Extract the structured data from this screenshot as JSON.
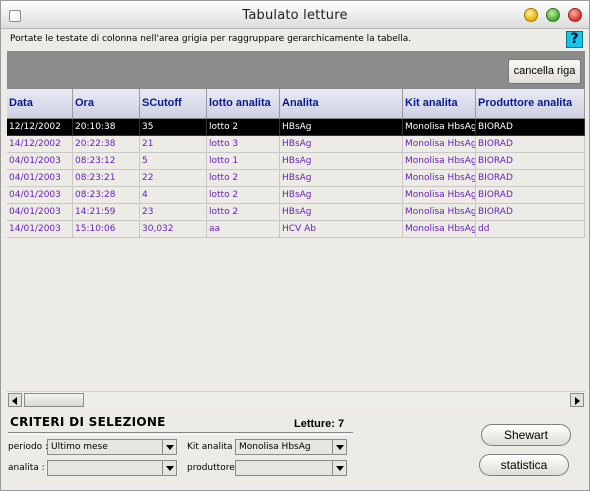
{
  "window": {
    "title": "Tabulato letture"
  },
  "instruction": "Portate le testate di colonna nell'area grigia per raggruppare gerarchicamente la tabella.",
  "help_label": "?",
  "cancella_label": "cancella riga",
  "table": {
    "columns": [
      "Data",
      "Ora",
      "SCutoff",
      "lotto analita",
      "Analita",
      "Kit analita",
      "Produttore analita"
    ],
    "rows": [
      [
        "12/12/2002",
        "20:10:38",
        "35",
        "lotto 2",
        "HBsAg",
        "Monolisa HbsAg",
        "BIORAD"
      ],
      [
        "14/12/2002",
        "20:22:38",
        "21",
        "lotto 3",
        "HBsAg",
        "Monolisa HbsAg",
        "BIORAD"
      ],
      [
        "04/01/2003",
        "08:23:12",
        "5",
        "lotto 1",
        "HBsAg",
        "Monolisa HbsAg",
        "BIORAD"
      ],
      [
        "04/01/2003",
        "08:23:21",
        "22",
        "lotto 2",
        "HBsAg",
        "Monolisa HbsAg",
        "BIORAD"
      ],
      [
        "04/01/2003",
        "08:23:28",
        "4",
        "lotto 2",
        "HBsAg",
        "Monolisa HbsAg",
        "BIORAD"
      ],
      [
        "04/01/2003",
        "14:21:59",
        "23",
        "lotto 2",
        "HBsAg",
        "Monolisa HbsAg",
        "BIORAD"
      ],
      [
        "14/01/2003",
        "15:10:06",
        "30,032",
        "aa",
        "HCV Ab",
        "Monolisa HbsAg",
        "dd"
      ]
    ],
    "selected_row": 0
  },
  "criteria": {
    "title": "CRITERI DI SELEZIONE",
    "letture": "Letture: 7",
    "periodo_label": "periodo :",
    "periodo_value": "Ultimo mese",
    "analita_label": "analita :",
    "analita_value": "",
    "kit_label": "Kit analita :",
    "kit_value": "Monolisa HbsAg",
    "produttore_label": "produttore :",
    "produttore_value": ""
  },
  "buttons": {
    "shewart": "Shewart",
    "statistica": "statistica"
  },
  "colors": {
    "header_text": "#0a1a8a",
    "row_text": "#6a22b8",
    "selected_bg": "#000000",
    "help_bg": "#10c8e8"
  }
}
